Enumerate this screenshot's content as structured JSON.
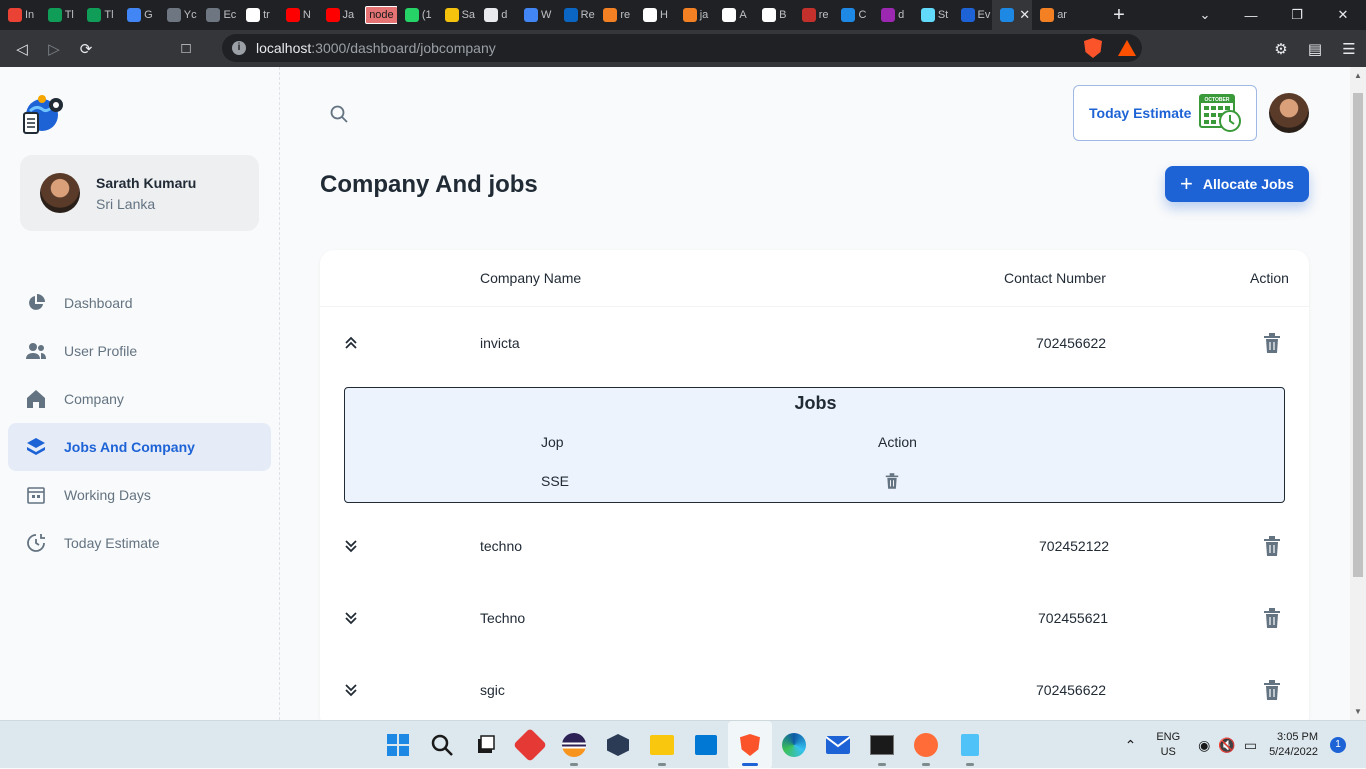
{
  "browser": {
    "tabs": [
      {
        "label": "In",
        "color": "#ea4335"
      },
      {
        "label": "Tl",
        "color": "#0f9d58"
      },
      {
        "label": "Tl",
        "color": "#0f9d58"
      },
      {
        "label": "G",
        "color": "#4285f4"
      },
      {
        "label": "Yc",
        "color": "#6e7681"
      },
      {
        "label": "Ec",
        "color": "#6e7681"
      },
      {
        "label": "tr",
        "color": "#ffffff"
      },
      {
        "label": "N",
        "color": "#ff0000"
      },
      {
        "label": "Ja",
        "color": "#ff0000"
      },
      {
        "label": "node",
        "color": "#e57373",
        "badge": true
      },
      {
        "label": "(1",
        "color": "#25d366"
      },
      {
        "label": "Sa",
        "color": "#f4c20d"
      },
      {
        "label": "d",
        "color": "#e8eaed"
      },
      {
        "label": "W",
        "color": "#4285f4"
      },
      {
        "label": "Re",
        "color": "#0a66c2"
      },
      {
        "label": "re",
        "color": "#f48024"
      },
      {
        "label": "H",
        "color": "#ffffff"
      },
      {
        "label": "ja",
        "color": "#f48024"
      },
      {
        "label": "A",
        "color": "#ffffff"
      },
      {
        "label": "B",
        "color": "#ffffff"
      },
      {
        "label": "re",
        "color": "#c4302b"
      },
      {
        "label": "C",
        "color": "#1e88e5"
      },
      {
        "label": "d",
        "color": "#9c27b0"
      },
      {
        "label": "St",
        "color": "#61dafb"
      },
      {
        "label": "Ev",
        "color": "#1e63d6"
      },
      {
        "label": "",
        "color": "#1e88e5",
        "active": true
      },
      {
        "label": "ar",
        "color": "#f48024"
      }
    ],
    "new_tab": "+",
    "url_host": "localhost",
    "url_path": ":3000/dashboard/jobcompany"
  },
  "sidebar": {
    "user_name": "Sarath Kumaru",
    "user_location": "Sri Lanka",
    "items": [
      {
        "label": "Dashboard",
        "icon": "pie-chart-icon"
      },
      {
        "label": "User Profile",
        "icon": "people-icon"
      },
      {
        "label": "Company",
        "icon": "home-icon"
      },
      {
        "label": "Jobs And Company",
        "icon": "layers-icon",
        "active": true
      },
      {
        "label": "Working Days",
        "icon": "calendar-icon"
      },
      {
        "label": "Today Estimate",
        "icon": "clock-refresh-icon"
      }
    ]
  },
  "header": {
    "estimate_label": "Today Estimate",
    "calendar_month": "OCTOBER"
  },
  "page": {
    "title": "Company And jobs",
    "allocate_label": "Allocate Jobs"
  },
  "table": {
    "columns": {
      "company": "Company Name",
      "contact": "Contact Number",
      "action": "Action"
    },
    "rows": [
      {
        "company": "invicta",
        "contact": "702456622",
        "expanded": true
      },
      {
        "company": "techno",
        "contact": "702452122"
      },
      {
        "company": "Techno",
        "contact": "702455621"
      },
      {
        "company": "sgic",
        "contact": "702456622"
      }
    ],
    "jobs": {
      "title": "Jobs",
      "col_job": "Jop",
      "col_action": "Action",
      "rows": [
        {
          "job": "SSE"
        }
      ]
    }
  },
  "taskbar": {
    "lang": "ENG",
    "region": "US",
    "time": "3:05 PM",
    "date": "5/24/2022",
    "notifications": "1"
  }
}
